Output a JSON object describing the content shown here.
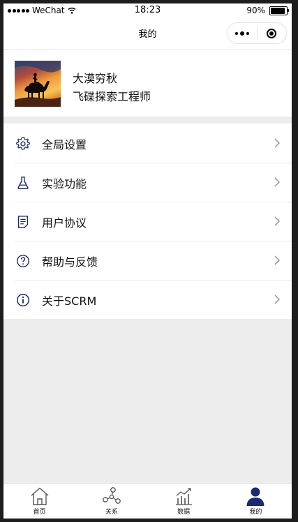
{
  "status_bar": {
    "carrier": "WeChat",
    "time": "18:23",
    "battery_text": "90%",
    "battery_level": 0.9
  },
  "nav": {
    "title": "我的"
  },
  "profile": {
    "name": "大漠穷秋",
    "title": "飞碟探索工程师"
  },
  "menu": [
    {
      "label": "全局设置",
      "icon": "gear-icon"
    },
    {
      "label": "实验功能",
      "icon": "flask-icon"
    },
    {
      "label": "用户协议",
      "icon": "document-icon"
    },
    {
      "label": "帮助与反馈",
      "icon": "question-icon"
    },
    {
      "label": "关于SCRM",
      "icon": "info-icon"
    }
  ],
  "tabs": [
    {
      "label": "首页",
      "icon": "home-icon",
      "active": false
    },
    {
      "label": "关系",
      "icon": "relation-icon",
      "active": false
    },
    {
      "label": "数据",
      "icon": "chart-icon",
      "active": false
    },
    {
      "label": "我的",
      "icon": "user-icon",
      "active": true
    }
  ],
  "colors": {
    "accent": "#1a2a6c",
    "icon_gray": "#555555",
    "background": "#ededed"
  }
}
